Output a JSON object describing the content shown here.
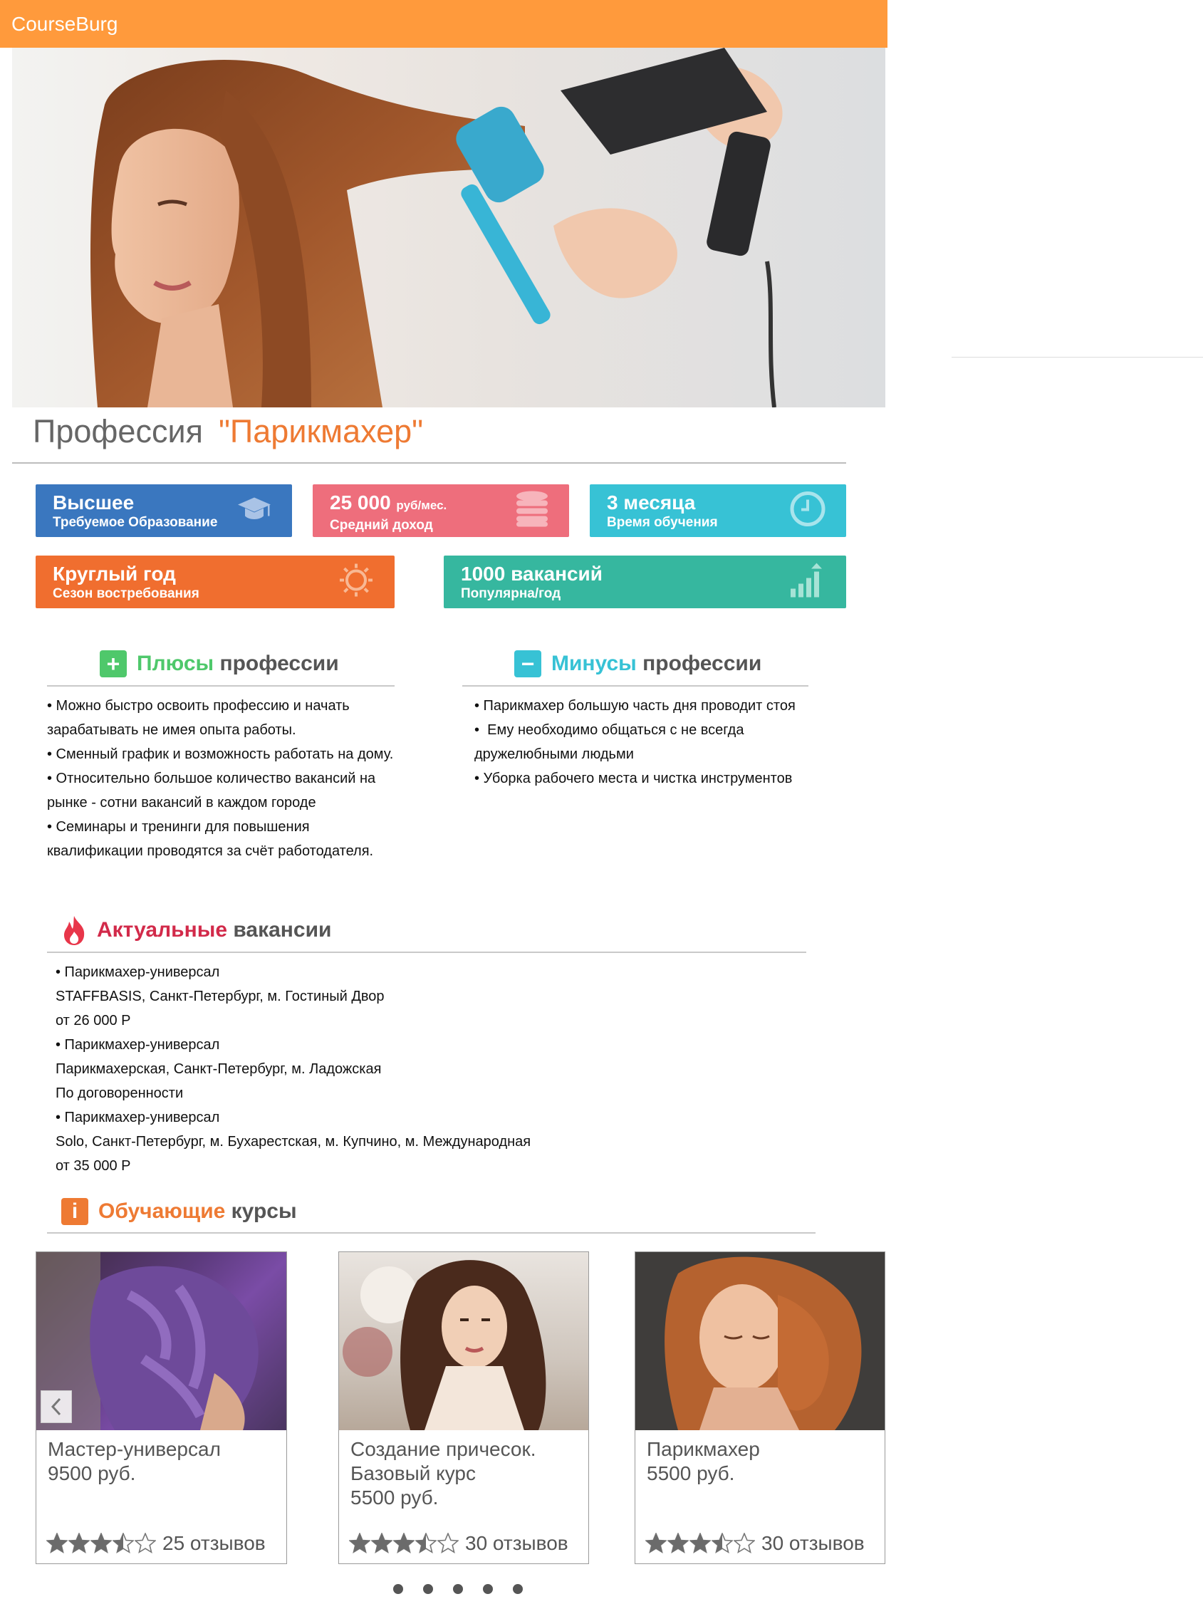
{
  "header": {
    "brand": "CourseBurg"
  },
  "profession": {
    "prefix": "Профессия",
    "name": "\"Парикмахер\""
  },
  "stats": {
    "education": {
      "value": "Высшее",
      "label": "Требуемое Образование",
      "icon": "graduation-cap-icon",
      "color": "#3a77bf"
    },
    "income": {
      "value": "25 000",
      "unit": "руб/мес.",
      "label": "Средний доход",
      "icon": "coins-stack-icon",
      "color": "#ee6e7c"
    },
    "duration": {
      "value": "3 месяца",
      "label": "Время обучения",
      "icon": "clock-icon",
      "color": "#37c2d5"
    },
    "season": {
      "value": "Круглый год",
      "label": "Сезон востребования",
      "icon": "sun-icon",
      "color": "#f06e2f"
    },
    "vacancies": {
      "value": "1000 вакансий",
      "label": "Популярна/год",
      "icon": "bar-growth-icon",
      "color": "#36b79f"
    }
  },
  "pros": {
    "title_accent": "Плюсы",
    "title_rest": " профессии",
    "icon": "plus-icon",
    "items": [
      "• Можно быстро освоить профессию и начать зарабатывать не имея опыта работы.",
      "• Сменный график и возможность работать на дому.",
      "• Относительно большое количество вакансий на рынке - сотни вакансий в каждом городе",
      "• Семинары и тренинги для повышения квалификации проводятся за счёт работодателя."
    ]
  },
  "cons": {
    "title_accent": "Минусы",
    "title_rest": " профессии",
    "icon": "minus-icon",
    "items": [
      "• Парикмахер большую часть дня проводит стоя",
      "•  Ему необходимо общаться с не всегда дружелюбными людьми",
      "• Уборка рабочего места и чистка инструментов"
    ]
  },
  "vacancies": {
    "title_accent": "Актуальные",
    "title_rest": " вакансии",
    "icon": "flame-icon",
    "items": [
      {
        "title": "• Парикмахер-универсал",
        "place": "STAFFBASIS, Санкт-Петербург, м. Гостиный Двор",
        "salary": "от 26 000 Р"
      },
      {
        "title": "• Парикмахер-универсал",
        "place": "Парикмахерская, Санкт-Петербург, м. Ладожская",
        "salary": "По договоренности"
      },
      {
        "title": "• Парикмахер-универсал",
        "place": "Solo, Санкт-Петербург, м. Бухарестская, м. Купчино, м. Международная",
        "salary": "от 35 000 Р"
      }
    ]
  },
  "courses": {
    "title_accent": "Обучающие",
    "title_rest": " курсы",
    "icon": "info-icon",
    "items": [
      {
        "name": "Мастер-универсал",
        "price": "9500 руб.",
        "reviews": "25 отзывов",
        "stars": 3.5
      },
      {
        "name": "Создание причесок. Базовый курс",
        "price": "5500 руб.",
        "reviews": "30 отзывов",
        "stars": 3.5
      },
      {
        "name": "Парикмахер",
        "price": "5500 руб.",
        "reviews": "30 отзывов",
        "stars": 3.5
      }
    ]
  },
  "carousel": {
    "prev_icon": "chevron-left-icon",
    "dots": 5
  }
}
